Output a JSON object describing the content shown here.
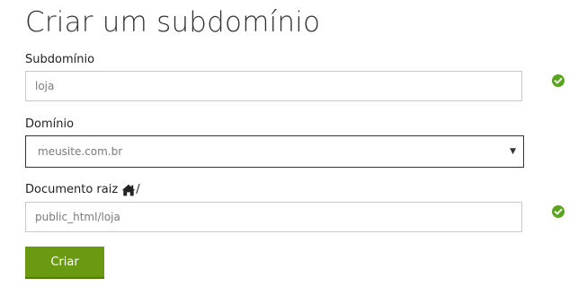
{
  "page": {
    "title": "Criar um subdomínio"
  },
  "form": {
    "subdomain": {
      "label": "Subdomínio",
      "value": "loja",
      "status_icon": "check-circle-icon"
    },
    "domain": {
      "label": "Domínio",
      "selected": "meusite.com.br",
      "arrow": "▼"
    },
    "docroot": {
      "label": "Documento raiz",
      "label_suffix": "/",
      "label_icon": "home-icon",
      "value": "public_html/loja",
      "status_icon": "check-circle-icon"
    },
    "submit_label": "Criar"
  },
  "colors": {
    "accent": "#6a9a12",
    "success": "#5aa51e"
  }
}
